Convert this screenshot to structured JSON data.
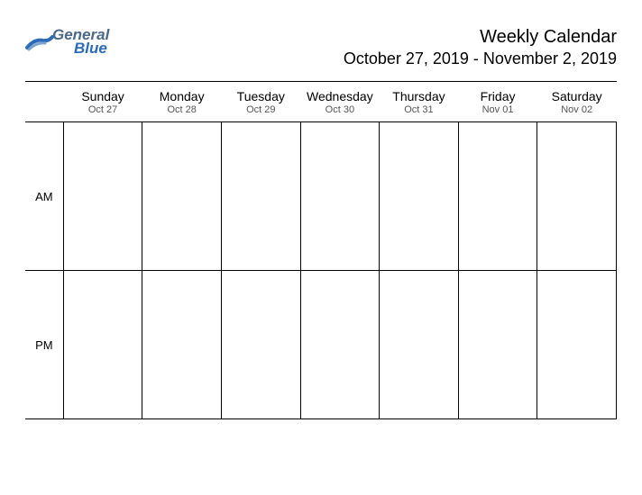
{
  "logo": {
    "text_top": "General",
    "text_bottom": "Blue",
    "accent_color": "#2b6cb8",
    "muted_color": "#4a6a8a"
  },
  "calendar": {
    "title": "Weekly Calendar",
    "date_range": "October 27, 2019 - November 2, 2019",
    "time_slots": [
      "AM",
      "PM"
    ],
    "days": [
      {
        "name": "Sunday",
        "date": "Oct 27"
      },
      {
        "name": "Monday",
        "date": "Oct 28"
      },
      {
        "name": "Tuesday",
        "date": "Oct 29"
      },
      {
        "name": "Wednesday",
        "date": "Oct 30"
      },
      {
        "name": "Thursday",
        "date": "Oct 31"
      },
      {
        "name": "Friday",
        "date": "Nov 01"
      },
      {
        "name": "Saturday",
        "date": "Nov 02"
      }
    ]
  }
}
